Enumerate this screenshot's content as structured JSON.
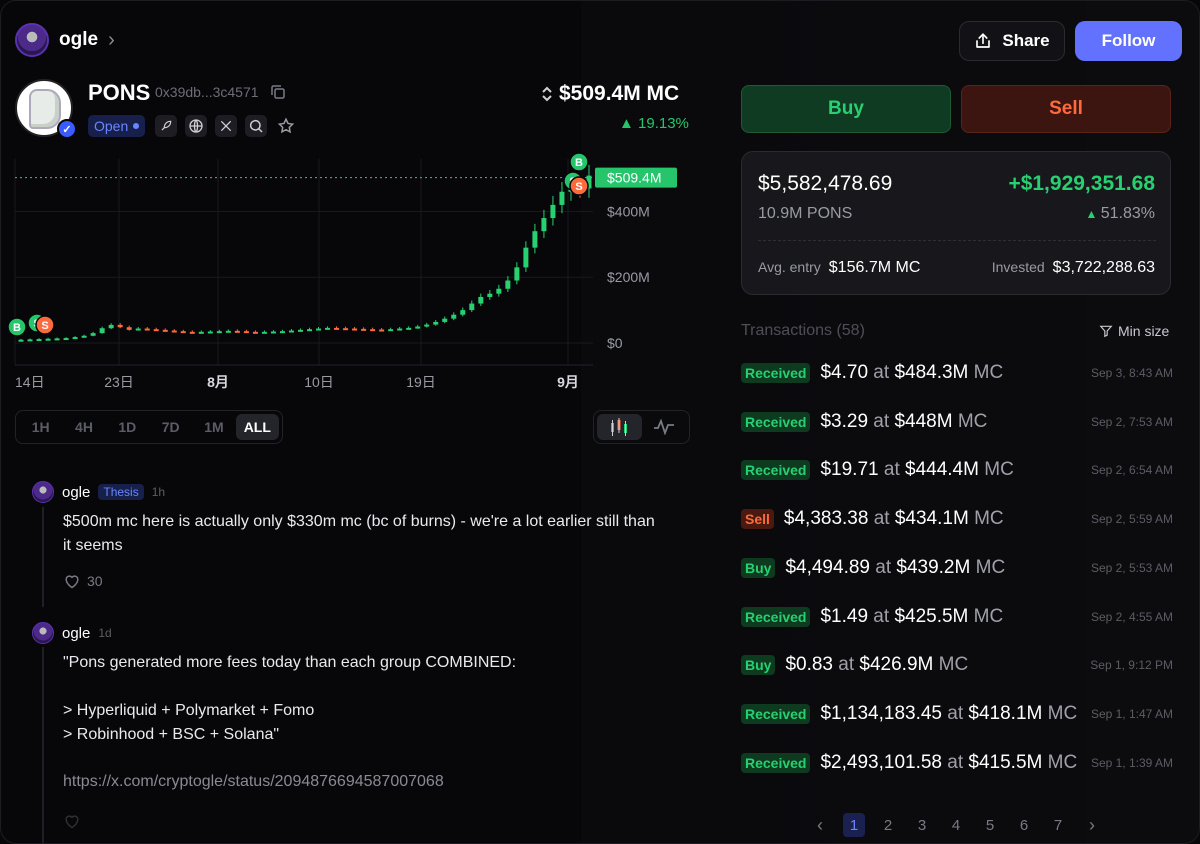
{
  "user": {
    "name": "ogle"
  },
  "header": {
    "share_label": "Share",
    "follow_label": "Follow"
  },
  "token": {
    "name": "PONS",
    "address": "0x39db...3c4571",
    "status": "Open",
    "market_cap": "$509.4M MC",
    "change": "19.13%"
  },
  "chart_data": {
    "type": "candlestick",
    "x_ticks": [
      "14日",
      "23日",
      "8月",
      "10日",
      "19日",
      "9月"
    ],
    "y_ticks": [
      "$0",
      "$200M",
      "$400M"
    ],
    "price_tag": "$509.4M",
    "ylim": [
      0,
      540
    ],
    "marker_labels": {
      "buy": "B",
      "sell": "S"
    },
    "series_approx": [
      10,
      11,
      12,
      13,
      14,
      15,
      18,
      22,
      30,
      45,
      55,
      48,
      40,
      44,
      42,
      40,
      38,
      36,
      34,
      33,
      34,
      35,
      36,
      37,
      36,
      34,
      33,
      34,
      35,
      36,
      38,
      40,
      42,
      44,
      46,
      45,
      44,
      43,
      42,
      41,
      40,
      42,
      44,
      46,
      50,
      56,
      64,
      74,
      86,
      100,
      120,
      140,
      150,
      165,
      190,
      230,
      290,
      340,
      380,
      420,
      460,
      480,
      470,
      509
    ]
  },
  "ranges": [
    "1H",
    "4H",
    "1D",
    "7D",
    "1M",
    "ALL"
  ],
  "active_range": "ALL",
  "posts": [
    {
      "author": "ogle",
      "tag": "Thesis",
      "time": "1h",
      "text": "$500m mc here is actually only $330m mc (bc of burns) - we're a lot earlier still than it seems",
      "likes": "30"
    },
    {
      "author": "ogle",
      "time": "1d",
      "text": "\"Pons generated more fees today than each group COMBINED:\n\n> Hyperliquid + Polymarket + Fomo\n> Robinhood + BSC + Solana\"",
      "link": "https://x.com/cryptogle/status/2094876694587007068"
    }
  ],
  "trade": {
    "buy_label": "Buy",
    "sell_label": "Sell"
  },
  "position": {
    "value": "$5,582,478.69",
    "pnl": "+$1,929,351.68",
    "tokens": "10.9M PONS",
    "pnl_pct": "51.83%",
    "avg_entry_label": "Avg. entry",
    "avg_entry": "$156.7M MC",
    "invested_label": "Invested",
    "invested": "$3,722,288.63"
  },
  "transactions": {
    "title": "Transactions (58)",
    "min_size_label": "Min size",
    "rows": [
      {
        "type": "Received",
        "amount": "$4.70",
        "at": "at",
        "mc": "$484.3M",
        "mc_suffix": "MC",
        "time": "Sep 3, 8:43 AM"
      },
      {
        "type": "Received",
        "amount": "$3.29",
        "at": "at",
        "mc": "$448M",
        "mc_suffix": "MC",
        "time": "Sep 2, 7:53 AM"
      },
      {
        "type": "Received",
        "amount": "$19.71",
        "at": "at",
        "mc": "$444.4M",
        "mc_suffix": "MC",
        "time": "Sep 2, 6:54 AM"
      },
      {
        "type": "Sell",
        "amount": "$4,383.38",
        "at": "at",
        "mc": "$434.1M",
        "mc_suffix": "MC",
        "time": "Sep 2, 5:59 AM"
      },
      {
        "type": "Buy",
        "amount": "$4,494.89",
        "at": "at",
        "mc": "$439.2M",
        "mc_suffix": "MC",
        "time": "Sep 2, 5:53 AM"
      },
      {
        "type": "Received",
        "amount": "$1.49",
        "at": "at",
        "mc": "$425.5M",
        "mc_suffix": "MC",
        "time": "Sep 2, 4:55 AM"
      },
      {
        "type": "Buy",
        "amount": "$0.83",
        "at": "at",
        "mc": "$426.9M",
        "mc_suffix": "MC",
        "time": "Sep 1, 9:12 PM"
      },
      {
        "type": "Received",
        "amount": "$1,134,183.45",
        "at": "at",
        "mc": "$418.1M",
        "mc_suffix": "MC",
        "time": "Sep 1, 1:47 AM"
      },
      {
        "type": "Received",
        "amount": "$2,493,101.58",
        "at": "at",
        "mc": "$415.5M",
        "mc_suffix": "MC",
        "time": "Sep 1, 1:39 AM"
      }
    ]
  },
  "pagination": {
    "pages": [
      "1",
      "2",
      "3",
      "4",
      "5",
      "6",
      "7"
    ],
    "active": "1"
  },
  "colors": {
    "green": "#27d070",
    "red": "#ff6a3d",
    "accent": "#6272ff"
  }
}
